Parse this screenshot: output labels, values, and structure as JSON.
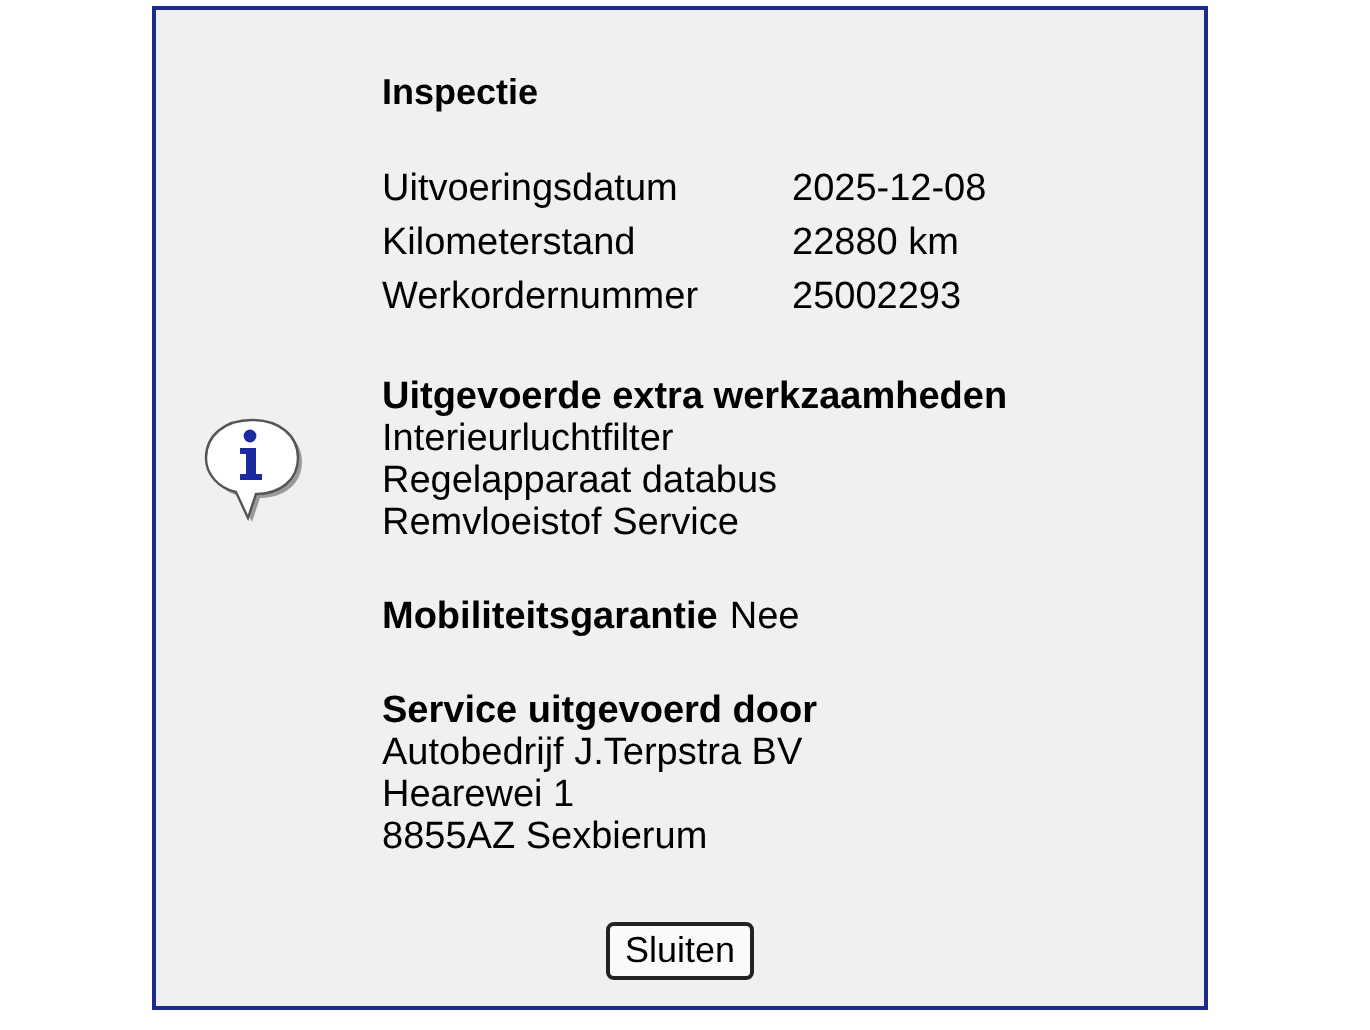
{
  "dialog": {
    "title": "Inspectie",
    "details": [
      {
        "label": "Uitvoeringsdatum",
        "value": "2025-12-08"
      },
      {
        "label": "Kilometerstand",
        "value": "22880 km"
      },
      {
        "label": "Werkordernummer",
        "value": "25002293"
      }
    ],
    "extra_work": {
      "heading": "Uitgevoerde extra werkzaamheden",
      "items": [
        "Interieurluchtfilter",
        "Regelapparaat databus",
        "Remvloeistof Service"
      ]
    },
    "mobility": {
      "label": "Mobiliteitsgarantie",
      "value": "Nee"
    },
    "service": {
      "heading": "Service uitgevoerd door",
      "lines": [
        "Autobedrijf J.Terpstra BV",
        "Hearewei 1",
        "8855AZ Sexbierum"
      ]
    },
    "buttons": [
      "Sluiten"
    ]
  }
}
